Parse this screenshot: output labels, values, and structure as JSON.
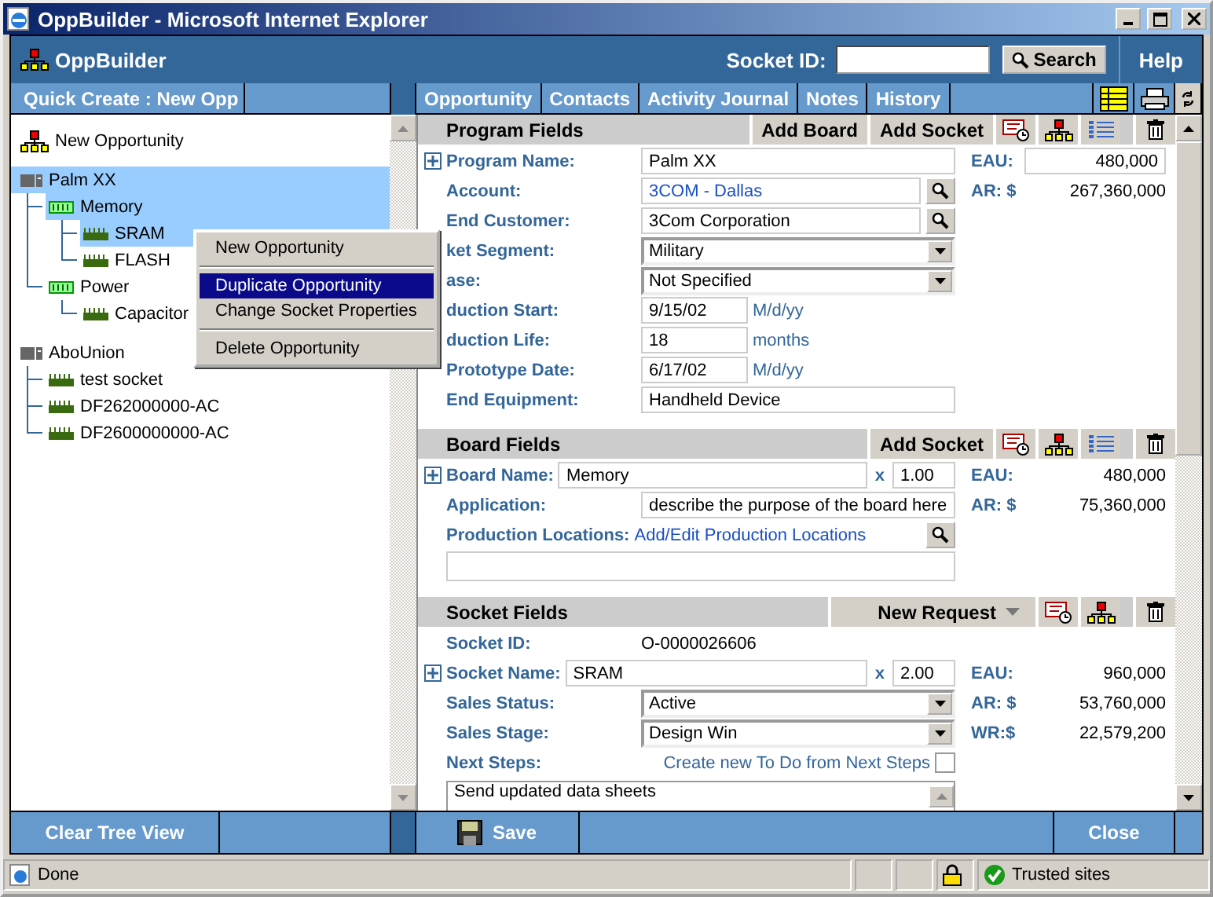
{
  "window": {
    "title": "OppBuilder - Microsoft Internet Explorer"
  },
  "header": {
    "app_name": "OppBuilder",
    "socket_id_label": "Socket ID:",
    "search_button": "Search",
    "help": "Help"
  },
  "left_tab": "Quick Create : New Opp",
  "tree": [
    {
      "label": "New Opportunity",
      "kind": "opportunity",
      "selected": false
    },
    {
      "label": "Palm XX",
      "kind": "program",
      "selected": true,
      "children": [
        {
          "label": "Memory",
          "kind": "board",
          "selected": true,
          "children": [
            {
              "label": "SRAM",
              "kind": "socket",
              "selected": true
            },
            {
              "label": "FLASH",
              "kind": "socket",
              "selected": false
            }
          ]
        },
        {
          "label": "Power",
          "kind": "board",
          "selected": false,
          "children": [
            {
              "label": "Capacitor",
              "kind": "socket",
              "selected": false
            }
          ]
        }
      ]
    },
    {
      "label": "AboUnion",
      "kind": "program",
      "selected": false,
      "children": [
        {
          "label": "test socket",
          "kind": "socket",
          "selected": false
        },
        {
          "label": "DF262000000-AC",
          "kind": "socket",
          "selected": false
        },
        {
          "label": "DF2600000000-AC",
          "kind": "socket",
          "selected": false
        }
      ]
    }
  ],
  "context_menu": [
    {
      "kind": "item",
      "label": "New Opportunity",
      "selected": false
    },
    {
      "kind": "separator"
    },
    {
      "kind": "item",
      "label": "Duplicate Opportunity",
      "selected": true
    },
    {
      "kind": "item",
      "label": "Change Socket Properties",
      "selected": false
    },
    {
      "kind": "separator"
    },
    {
      "kind": "item",
      "label": "Delete Opportunity",
      "selected": false
    }
  ],
  "tabs": [
    {
      "label": "Opportunity",
      "selected": false
    },
    {
      "label": "Contacts",
      "selected": false
    },
    {
      "label": "Activity Journal",
      "selected": false
    },
    {
      "label": "Notes",
      "selected": false
    },
    {
      "label": "History",
      "selected": false
    }
  ],
  "sections": [
    {
      "title": "Program Fields",
      "actions": [
        {
          "kind": "text",
          "label": "Add Board"
        },
        {
          "kind": "text",
          "label": "Add Socket"
        },
        {
          "kind": "schedule"
        },
        {
          "kind": "hierarchy"
        },
        {
          "kind": "list"
        },
        {
          "kind": "delete"
        }
      ],
      "fields": [
        {
          "kind": "input",
          "label": "Program Name:",
          "value": "Palm XX",
          "expandable": true,
          "total": {
            "kind": "input",
            "label": "EAU:",
            "value": "480,000"
          }
        },
        {
          "kind": "lookup",
          "label": "Account:",
          "value": "3COM - Dallas",
          "linked": true,
          "total": {
            "kind": "text",
            "label": "AR: $",
            "value": "267,360,000"
          }
        },
        {
          "kind": "lookup",
          "label": "End Customer:",
          "value": "3Com Corporation",
          "linked": false
        },
        {
          "kind": "select",
          "label": "ket Segment:",
          "value": "Military"
        },
        {
          "kind": "select",
          "label": "ase:",
          "value": "Not Specified"
        },
        {
          "kind": "date",
          "label": "duction Start:",
          "value": "9/15/02",
          "hint": "M/d/yy"
        },
        {
          "kind": "date",
          "label": "duction Life:",
          "value": "18",
          "hint": "months"
        },
        {
          "kind": "date",
          "label": "Prototype Date:",
          "value": "6/17/02",
          "hint": "M/d/yy"
        },
        {
          "kind": "input",
          "label": "End Equipment:",
          "value": "Handheld Device"
        }
      ]
    },
    {
      "title": "Board Fields",
      "actions": [
        {
          "kind": "text",
          "label": "Add Socket"
        },
        {
          "kind": "schedule"
        },
        {
          "kind": "hierarchy"
        },
        {
          "kind": "list"
        },
        {
          "kind": "delete"
        }
      ],
      "fields": [
        {
          "kind": "name-qty",
          "label": "Board Name:",
          "value": "Memory",
          "quantity": "1.00",
          "times": "x",
          "expandable": true,
          "total": {
            "kind": "text",
            "label": "EAU:",
            "value": "480,000"
          }
        },
        {
          "kind": "input",
          "label": "Application:",
          "value": "describe the purpose of the board here",
          "total": {
            "kind": "text",
            "label": "AR: $",
            "value": "75,360,000"
          }
        },
        {
          "kind": "link-lookup",
          "label": "Production Locations:",
          "link": "Add/Edit Production Locations"
        },
        {
          "kind": "box"
        }
      ]
    },
    {
      "title": "Socket Fields",
      "actions": [
        {
          "kind": "menu",
          "label": "New Request"
        },
        {
          "kind": "schedule"
        },
        {
          "kind": "hierarchy"
        },
        {
          "kind": "delete"
        }
      ],
      "fields": [
        {
          "kind": "text",
          "label": "Socket ID:",
          "value": "O-0000026606"
        },
        {
          "kind": "name-qty",
          "label": "Socket Name:",
          "value": "SRAM",
          "quantity": "2.00",
          "times": "x",
          "expandable": true,
          "total": {
            "kind": "text",
            "label": "EAU:",
            "value": "960,000"
          }
        },
        {
          "kind": "select",
          "label": "Sales Status:",
          "value": "Active",
          "total": {
            "kind": "text",
            "label": "AR: $",
            "value": "53,760,000"
          }
        },
        {
          "kind": "select",
          "label": "Sales Stage:",
          "value": "Design Win",
          "total": {
            "kind": "text",
            "label": "WR:$",
            "value": "22,579,200"
          }
        },
        {
          "kind": "link-check",
          "label": "Next Steps:",
          "link": "Create new To Do from Next Steps",
          "checked": false
        },
        {
          "kind": "memo",
          "value": "Send updated data sheets"
        }
      ]
    }
  ],
  "footer": {
    "clear_button": "Clear Tree View",
    "save_button": "Save",
    "close_button": "Close"
  },
  "status_bar": {
    "text": "Done",
    "zone": "Trusted sites"
  }
}
